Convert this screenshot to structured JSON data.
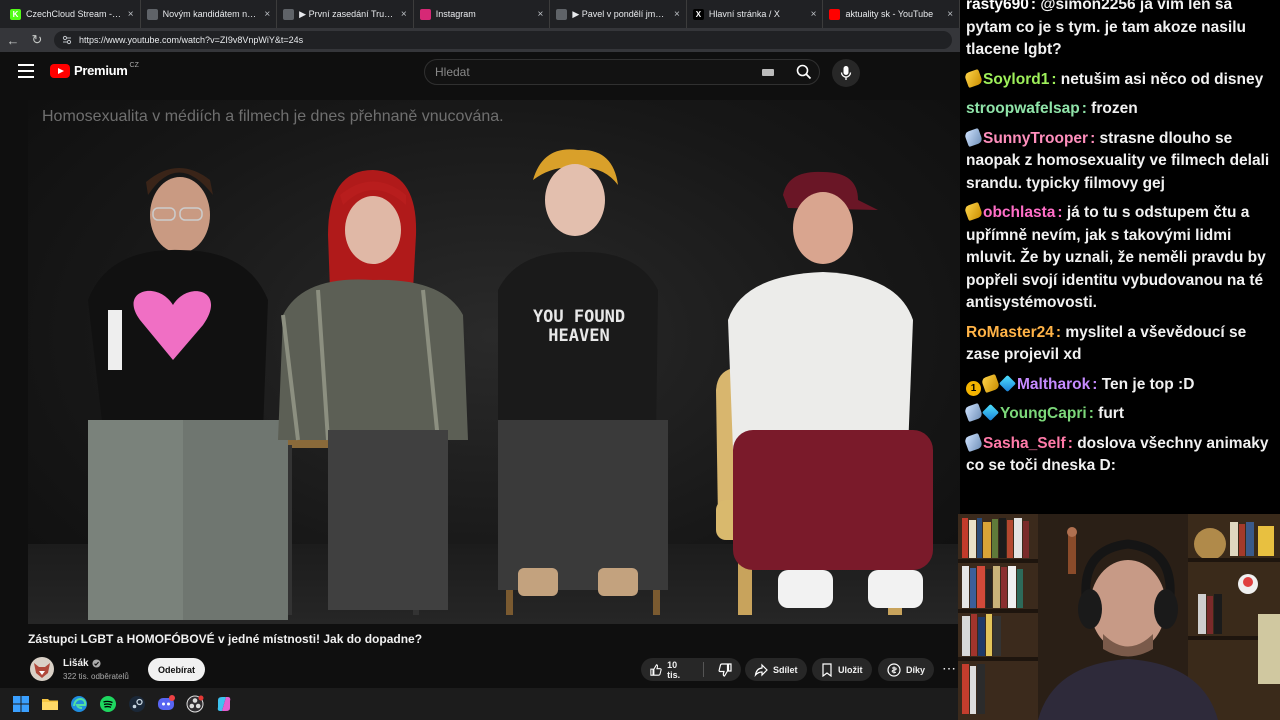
{
  "browser": {
    "tabs": [
      {
        "title": "CzechCloud Stream - Watch M",
        "fav_color": "#53fc18",
        "fav_glyph": "K"
      },
      {
        "title": "Novým kandidátem na minist",
        "fav_color": "#5f6368",
        "fav_glyph": ""
      },
      {
        "title": "▶ První zasedání Trumpovy R",
        "fav_color": "#5f6368",
        "fav_glyph": ""
      },
      {
        "title": "Instagram",
        "fav_color": "#d62976",
        "fav_glyph": ""
      },
      {
        "title": "▶ Pavel v pondělí jmenuje Čes",
        "fav_color": "#5f6368",
        "fav_glyph": ""
      },
      {
        "title": "Hlavní stránka / X",
        "fav_color": "#000000",
        "fav_glyph": "X"
      },
      {
        "title": "aktuality sk - YouTube",
        "fav_color": "#ff0000",
        "fav_glyph": ""
      }
    ],
    "url": "https://www.youtube.com/watch?v=ZI9v8VnpWiY&t=24s"
  },
  "youtube": {
    "logo_word": "Premium",
    "logo_region": "CZ",
    "search_placeholder": "Hledat",
    "video_caption": "Homosexualita v médiích a filmech je dnes přehnaně vnucována.",
    "shirt_text_1": "YOU FOUND",
    "shirt_text_2": "HEAVEN",
    "video_title": "Zástupci LGBT a HOMOFÓBOVÉ v jedné místnosti! Jak do dopadne?",
    "channel_name": "Lišák",
    "channel_subs": "322 tis. odběratelů",
    "subscribe_label": "Odebírat",
    "likes": "10 tis.",
    "share_label": "Sdílet",
    "save_label": "Uložit",
    "thanks_label": "Díky",
    "brand_color": "#ff0000"
  },
  "chat": {
    "messages": [
      {
        "user": "rasty690",
        "color": "#ffffff",
        "badges": [],
        "text": "@simon2256 ja vim len sa pytam co je s tym. je tam akoze nasilu tlacene lgbt?"
      },
      {
        "user": "Soylord1",
        "color": "#9ef05a",
        "badges": [
          "sub"
        ],
        "text": "netušim asi něco od disney"
      },
      {
        "user": "stroopwafelsap",
        "color": "#8fe3a8",
        "badges": [],
        "text": "frozen"
      },
      {
        "user": "SunnyTrooper",
        "color": "#ff8fbd",
        "badges": [
          "tier"
        ],
        "text": "strasne dlouho se naopak z homosexuality ve filmech delali srandu. typicky filmovy gej"
      },
      {
        "user": "obchlasta",
        "color": "#ff6ec7",
        "badges": [
          "sub"
        ],
        "text": "já to tu s odstupem čtu a upřímně nevím, jak s takovými lidmi mluvit. Že by uznali, že neměli pravdu by popřeli svojí identitu vybudovanou na té antisystémovosti."
      },
      {
        "user": "RoMaster24",
        "color": "#ffb347",
        "badges": [],
        "text": "myslitel a vševědoucí se zase projevil xd"
      },
      {
        "user": "Maltharok",
        "color": "#c58bff",
        "badges": [
          "one",
          "sub",
          "gem"
        ],
        "text": "Ten je top :D"
      },
      {
        "user": "YoungCapri",
        "color": "#7cd87a",
        "badges": [
          "tier",
          "gem"
        ],
        "text": "furt"
      },
      {
        "user": "Sasha_Self",
        "color": "#ff7aa8",
        "badges": [
          "tier"
        ],
        "text": "doslova všechny animaky co se toči dneska D:"
      }
    ]
  }
}
